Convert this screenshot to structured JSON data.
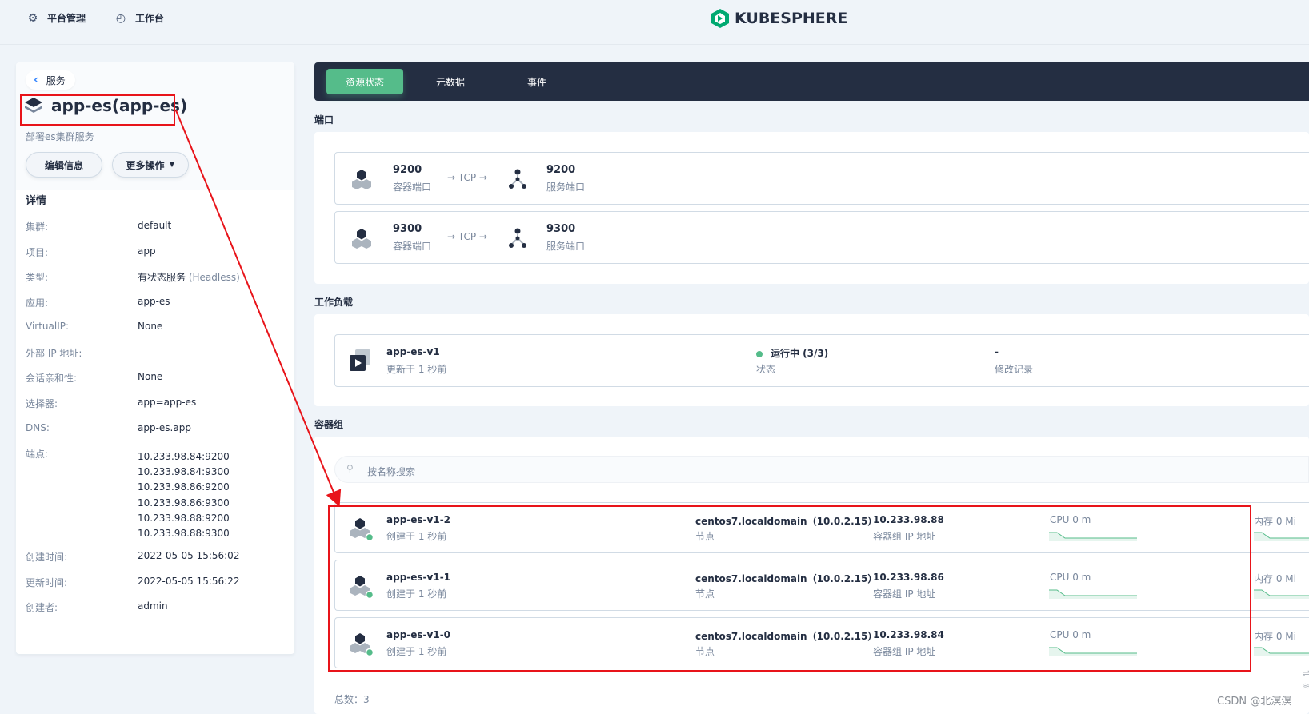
{
  "topbar": {
    "platform_label": "平台管理",
    "workbench_label": "工作台",
    "logo_text": "KUBESPHERE"
  },
  "sidebar": {
    "back_label": "服务",
    "service_name": "app-es(app-es)",
    "description": "部署es集群服务",
    "edit_label": "编辑信息",
    "more_label": "更多操作",
    "details_title": "详情",
    "details": [
      {
        "key": "集群:",
        "value": "default"
      },
      {
        "key": "项目:",
        "value": "app"
      },
      {
        "key": "类型:",
        "value": "有状态服务",
        "sub": "(Headless)"
      },
      {
        "key": "应用:",
        "value": "app-es"
      },
      {
        "key": "VirtualIP:",
        "value": "None"
      },
      {
        "key": "外部 IP 地址:",
        "value": ""
      },
      {
        "key": "会话亲和性:",
        "value": "None"
      },
      {
        "key": "选择器:",
        "value": "app=app-es"
      },
      {
        "key": "DNS:",
        "value": "app-es.app"
      },
      {
        "key": "端点:",
        "value": ""
      }
    ],
    "endpoints": [
      "10.233.98.84:9200",
      "10.233.98.84:9300",
      "10.233.98.86:9200",
      "10.233.98.86:9300",
      "10.233.98.88:9200",
      "10.233.98.88:9300"
    ],
    "meta": [
      {
        "key": "创建时间:",
        "value": "2022-05-05 15:56:02"
      },
      {
        "key": "更新时间:",
        "value": "2022-05-05 15:56:22"
      },
      {
        "key": "创建者:",
        "value": "admin"
      }
    ]
  },
  "tabs": [
    "资源状态",
    "元数据",
    "事件"
  ],
  "ports": {
    "section_label": "端口",
    "rows": [
      {
        "container_port": "9200",
        "container_label": "容器端口",
        "protocol": "→ TCP →",
        "service_port": "9200",
        "service_label": "服务端口"
      },
      {
        "container_port": "9300",
        "container_label": "容器端口",
        "protocol": "→ TCP →",
        "service_port": "9300",
        "service_label": "服务端口"
      }
    ]
  },
  "workload": {
    "section_label": "工作负载",
    "name": "app-es-v1",
    "updated": "更新于 1 秒前",
    "status": "运行中 (3/3)",
    "status_label": "状态",
    "revision": "-",
    "revision_label": "修改记录"
  },
  "pods": {
    "section_label": "容器组",
    "search_placeholder": "按名称搜索",
    "rows": [
      {
        "name": "app-es-v1-2",
        "created": "创建于 1 秒前",
        "node": "centos7.localdomain（10.0.2.15）",
        "node_label": "节点",
        "ip": "10.233.98.88",
        "ip_label": "容器组 IP 地址",
        "cpu": "CPU 0 m",
        "mem": "内存 0 Mi"
      },
      {
        "name": "app-es-v1-1",
        "created": "创建于 1 秒前",
        "node": "centos7.localdomain（10.0.2.15）",
        "node_label": "节点",
        "ip": "10.233.98.86",
        "ip_label": "容器组 IP 地址",
        "cpu": "CPU 0 m",
        "mem": "内存 0 Mi"
      },
      {
        "name": "app-es-v1-0",
        "created": "创建于 1 秒前",
        "node": "centos7.localdomain（10.0.2.15）",
        "node_label": "节点",
        "ip": "10.233.98.84",
        "ip_label": "容器组 IP 地址",
        "cpu": "CPU 0 m",
        "mem": "内存 0 Mi"
      }
    ],
    "total": "总数：3"
  },
  "watermark": "CSDN @北溟溟",
  "colors": {
    "accent": "#55bc8a",
    "dark": "#242e42",
    "annotation": "#e8141a"
  }
}
